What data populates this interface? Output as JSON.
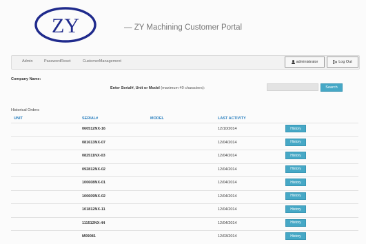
{
  "logo": {
    "text": "ZY"
  },
  "portal_title": "— ZY Machining Customer Portal",
  "nav": {
    "links": [
      "Admin",
      "PasswordReset",
      "CustomerManagement"
    ],
    "user_label": "administrator",
    "logout_label": "Log Out"
  },
  "company_label": "Company Name:",
  "search": {
    "prompt": "Enter Serial#, Unit or Model",
    "hint": "(maximum 40 characters):",
    "value": "",
    "button_label": "Search"
  },
  "orders": {
    "section_label": "Historical Orders",
    "columns": [
      "UNIT",
      "SERIAL#",
      "MODEL",
      "LAST ACTIVITY"
    ],
    "history_label": "History",
    "rows": [
      {
        "unit": "",
        "serial": "060512NX-16",
        "model": "",
        "last_activity": "12/10/2014"
      },
      {
        "unit": "",
        "serial": "081613NX-07",
        "model": "",
        "last_activity": "12/04/2014"
      },
      {
        "unit": "",
        "serial": "082511NX-03",
        "model": "",
        "last_activity": "12/04/2014"
      },
      {
        "unit": "",
        "serial": "092812NX-02",
        "model": "",
        "last_activity": "12/04/2014"
      },
      {
        "unit": "",
        "serial": "100608NX-01",
        "model": "",
        "last_activity": "12/04/2014"
      },
      {
        "unit": "",
        "serial": "100609NX-02",
        "model": "",
        "last_activity": "12/04/2014"
      },
      {
        "unit": "",
        "serial": "101812NX-11",
        "model": "",
        "last_activity": "12/04/2014"
      },
      {
        "unit": "",
        "serial": "111512NX-44",
        "model": "",
        "last_activity": "12/04/2014"
      },
      {
        "unit": "",
        "serial": "M09081",
        "model": "",
        "last_activity": "12/03/2014"
      }
    ]
  },
  "colors": {
    "accent": "#46a8c6",
    "header_link": "#2a7fbf",
    "logo": "#1f2a8c"
  }
}
